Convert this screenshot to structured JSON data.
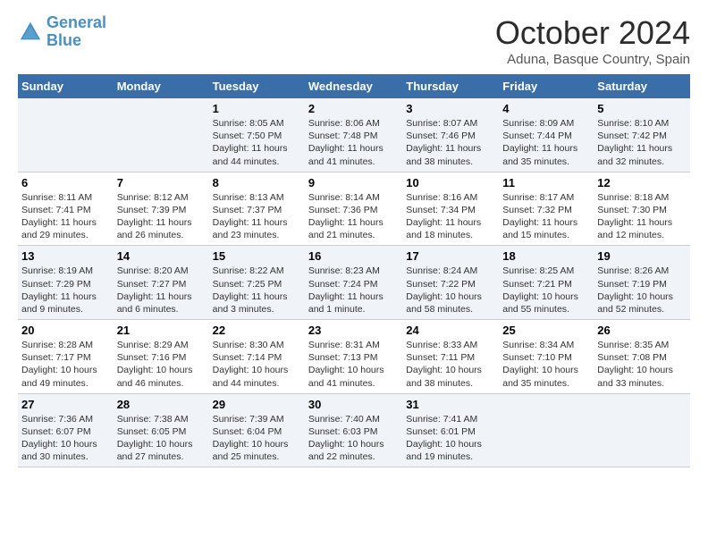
{
  "logo": {
    "line1": "General",
    "line2": "Blue"
  },
  "title": "October 2024",
  "location": "Aduna, Basque Country, Spain",
  "days_header": [
    "Sunday",
    "Monday",
    "Tuesday",
    "Wednesday",
    "Thursday",
    "Friday",
    "Saturday"
  ],
  "weeks": [
    [
      {
        "day": "",
        "sunrise": "",
        "sunset": "",
        "daylight": ""
      },
      {
        "day": "",
        "sunrise": "",
        "sunset": "",
        "daylight": ""
      },
      {
        "day": "1",
        "sunrise": "Sunrise: 8:05 AM",
        "sunset": "Sunset: 7:50 PM",
        "daylight": "Daylight: 11 hours and 44 minutes."
      },
      {
        "day": "2",
        "sunrise": "Sunrise: 8:06 AM",
        "sunset": "Sunset: 7:48 PM",
        "daylight": "Daylight: 11 hours and 41 minutes."
      },
      {
        "day": "3",
        "sunrise": "Sunrise: 8:07 AM",
        "sunset": "Sunset: 7:46 PM",
        "daylight": "Daylight: 11 hours and 38 minutes."
      },
      {
        "day": "4",
        "sunrise": "Sunrise: 8:09 AM",
        "sunset": "Sunset: 7:44 PM",
        "daylight": "Daylight: 11 hours and 35 minutes."
      },
      {
        "day": "5",
        "sunrise": "Sunrise: 8:10 AM",
        "sunset": "Sunset: 7:42 PM",
        "daylight": "Daylight: 11 hours and 32 minutes."
      }
    ],
    [
      {
        "day": "6",
        "sunrise": "Sunrise: 8:11 AM",
        "sunset": "Sunset: 7:41 PM",
        "daylight": "Daylight: 11 hours and 29 minutes."
      },
      {
        "day": "7",
        "sunrise": "Sunrise: 8:12 AM",
        "sunset": "Sunset: 7:39 PM",
        "daylight": "Daylight: 11 hours and 26 minutes."
      },
      {
        "day": "8",
        "sunrise": "Sunrise: 8:13 AM",
        "sunset": "Sunset: 7:37 PM",
        "daylight": "Daylight: 11 hours and 23 minutes."
      },
      {
        "day": "9",
        "sunrise": "Sunrise: 8:14 AM",
        "sunset": "Sunset: 7:36 PM",
        "daylight": "Daylight: 11 hours and 21 minutes."
      },
      {
        "day": "10",
        "sunrise": "Sunrise: 8:16 AM",
        "sunset": "Sunset: 7:34 PM",
        "daylight": "Daylight: 11 hours and 18 minutes."
      },
      {
        "day": "11",
        "sunrise": "Sunrise: 8:17 AM",
        "sunset": "Sunset: 7:32 PM",
        "daylight": "Daylight: 11 hours and 15 minutes."
      },
      {
        "day": "12",
        "sunrise": "Sunrise: 8:18 AM",
        "sunset": "Sunset: 7:30 PM",
        "daylight": "Daylight: 11 hours and 12 minutes."
      }
    ],
    [
      {
        "day": "13",
        "sunrise": "Sunrise: 8:19 AM",
        "sunset": "Sunset: 7:29 PM",
        "daylight": "Daylight: 11 hours and 9 minutes."
      },
      {
        "day": "14",
        "sunrise": "Sunrise: 8:20 AM",
        "sunset": "Sunset: 7:27 PM",
        "daylight": "Daylight: 11 hours and 6 minutes."
      },
      {
        "day": "15",
        "sunrise": "Sunrise: 8:22 AM",
        "sunset": "Sunset: 7:25 PM",
        "daylight": "Daylight: 11 hours and 3 minutes."
      },
      {
        "day": "16",
        "sunrise": "Sunrise: 8:23 AM",
        "sunset": "Sunset: 7:24 PM",
        "daylight": "Daylight: 11 hours and 1 minute."
      },
      {
        "day": "17",
        "sunrise": "Sunrise: 8:24 AM",
        "sunset": "Sunset: 7:22 PM",
        "daylight": "Daylight: 10 hours and 58 minutes."
      },
      {
        "day": "18",
        "sunrise": "Sunrise: 8:25 AM",
        "sunset": "Sunset: 7:21 PM",
        "daylight": "Daylight: 10 hours and 55 minutes."
      },
      {
        "day": "19",
        "sunrise": "Sunrise: 8:26 AM",
        "sunset": "Sunset: 7:19 PM",
        "daylight": "Daylight: 10 hours and 52 minutes."
      }
    ],
    [
      {
        "day": "20",
        "sunrise": "Sunrise: 8:28 AM",
        "sunset": "Sunset: 7:17 PM",
        "daylight": "Daylight: 10 hours and 49 minutes."
      },
      {
        "day": "21",
        "sunrise": "Sunrise: 8:29 AM",
        "sunset": "Sunset: 7:16 PM",
        "daylight": "Daylight: 10 hours and 46 minutes."
      },
      {
        "day": "22",
        "sunrise": "Sunrise: 8:30 AM",
        "sunset": "Sunset: 7:14 PM",
        "daylight": "Daylight: 10 hours and 44 minutes."
      },
      {
        "day": "23",
        "sunrise": "Sunrise: 8:31 AM",
        "sunset": "Sunset: 7:13 PM",
        "daylight": "Daylight: 10 hours and 41 minutes."
      },
      {
        "day": "24",
        "sunrise": "Sunrise: 8:33 AM",
        "sunset": "Sunset: 7:11 PM",
        "daylight": "Daylight: 10 hours and 38 minutes."
      },
      {
        "day": "25",
        "sunrise": "Sunrise: 8:34 AM",
        "sunset": "Sunset: 7:10 PM",
        "daylight": "Daylight: 10 hours and 35 minutes."
      },
      {
        "day": "26",
        "sunrise": "Sunrise: 8:35 AM",
        "sunset": "Sunset: 7:08 PM",
        "daylight": "Daylight: 10 hours and 33 minutes."
      }
    ],
    [
      {
        "day": "27",
        "sunrise": "Sunrise: 7:36 AM",
        "sunset": "Sunset: 6:07 PM",
        "daylight": "Daylight: 10 hours and 30 minutes."
      },
      {
        "day": "28",
        "sunrise": "Sunrise: 7:38 AM",
        "sunset": "Sunset: 6:05 PM",
        "daylight": "Daylight: 10 hours and 27 minutes."
      },
      {
        "day": "29",
        "sunrise": "Sunrise: 7:39 AM",
        "sunset": "Sunset: 6:04 PM",
        "daylight": "Daylight: 10 hours and 25 minutes."
      },
      {
        "day": "30",
        "sunrise": "Sunrise: 7:40 AM",
        "sunset": "Sunset: 6:03 PM",
        "daylight": "Daylight: 10 hours and 22 minutes."
      },
      {
        "day": "31",
        "sunrise": "Sunrise: 7:41 AM",
        "sunset": "Sunset: 6:01 PM",
        "daylight": "Daylight: 10 hours and 19 minutes."
      },
      {
        "day": "",
        "sunrise": "",
        "sunset": "",
        "daylight": ""
      },
      {
        "day": "",
        "sunrise": "",
        "sunset": "",
        "daylight": ""
      }
    ]
  ]
}
